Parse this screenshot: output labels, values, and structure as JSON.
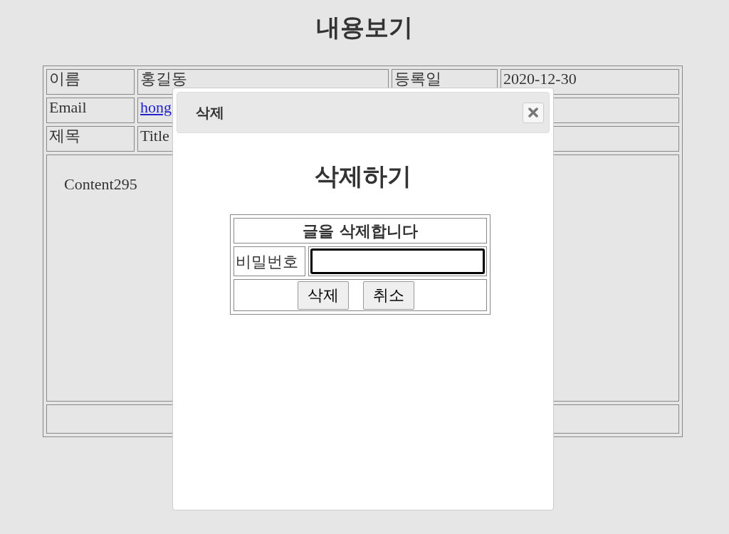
{
  "page_title": "내용보기",
  "post": {
    "rows": [
      {
        "cells": [
          {
            "kind": "label",
            "text": "이름"
          },
          {
            "kind": "value",
            "text": "홍길동"
          },
          {
            "kind": "label",
            "text": "등록일"
          },
          {
            "kind": "value",
            "text": "2020-12-30"
          }
        ]
      },
      {
        "cells": [
          {
            "kind": "label",
            "text": "Email"
          },
          {
            "kind": "link",
            "text": "hong"
          }
        ]
      },
      {
        "cells": [
          {
            "kind": "label",
            "text": "제목"
          },
          {
            "kind": "value",
            "text": "Title"
          }
        ]
      }
    ],
    "content": "Content295"
  },
  "dialog": {
    "title": "삭제",
    "heading": "삭제하기",
    "form": {
      "caption": "글을 삭제합니다",
      "password_label": "비밀번호",
      "password_focused": true,
      "buttons": [
        "삭제",
        "취소"
      ]
    }
  }
}
